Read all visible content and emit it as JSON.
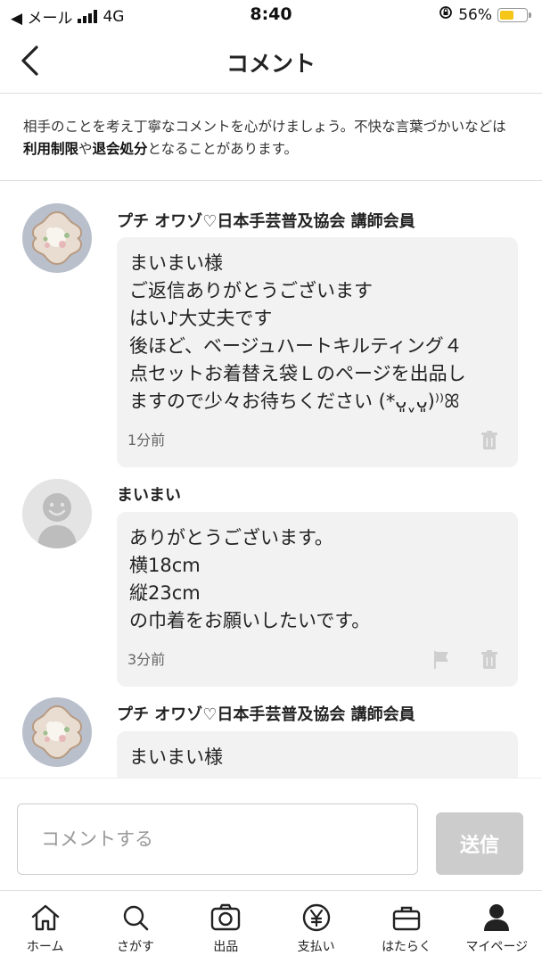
{
  "status_bar": {
    "back_label": "◀ メール",
    "network": "4G",
    "time": "8:40",
    "battery": "56%",
    "battery_level": 0.56
  },
  "header": {
    "title": "コメント"
  },
  "notice": {
    "text_before": "相手のことを考え丁寧なコメントを心がけましょう。不快な言葉づかいなどは",
    "link1": "利用制限",
    "text_mid": "や",
    "link2": "退会処分",
    "text_after": "となることがあります。"
  },
  "comments": [
    {
      "user": "プチ オワゾ♡日本手芸普及協会 講師会員",
      "lines": [
        "まいまい様",
        "ご返信ありがとうございます",
        "はい♪大丈夫です",
        "後ほど、ベージュハートキルティング４",
        "点セットお着替え袋Ｌのページを出品し",
        "ますので少々お待ちください (*ᴗ͈ˬᴗ͈)⁾⁾ꕤ"
      ],
      "time": "1分前"
    },
    {
      "user": "まいまい",
      "lines": [
        "ありがとうございます。",
        "横18cm",
        "縦23cm",
        "の巾着をお願いしたいです。"
      ],
      "time": "3分前"
    },
    {
      "user": "プチ オワゾ♡日本手芸普及協会 講師会員",
      "lines": [
        "まいまい様"
      ]
    }
  ],
  "input": {
    "placeholder": "コメントする",
    "send_label": "送信"
  },
  "tabbar": [
    {
      "label": "ホーム",
      "icon": "home-icon"
    },
    {
      "label": "さがす",
      "icon": "search-icon"
    },
    {
      "label": "出品",
      "icon": "camera-icon"
    },
    {
      "label": "支払い",
      "icon": "yen-icon"
    },
    {
      "label": "はたらく",
      "icon": "briefcase-icon"
    },
    {
      "label": "マイページ",
      "icon": "person-icon"
    }
  ]
}
